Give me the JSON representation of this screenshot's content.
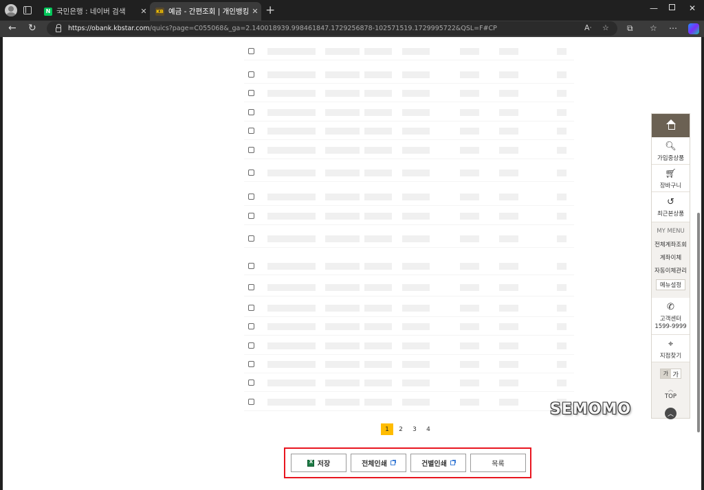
{
  "browser": {
    "tabs": [
      {
        "title": "국민은행 : 네이버 검색",
        "favicon": "N"
      },
      {
        "title": "예금 - 간편조회 | 개인뱅킹 | 조회",
        "favicon": "KB"
      }
    ],
    "url_host": "https://obank.kbstar.com",
    "url_path": "/quics?page=C055068&_ga=2.140018939.998461847.1729256878-102571519.1729995722&QSL=F#CP"
  },
  "pagination": {
    "pages": [
      "1",
      "2",
      "3",
      "4"
    ],
    "active": "1"
  },
  "actions": {
    "save": "저장",
    "print_all": "전체인쇄",
    "print_each": "건별인쇄",
    "list": "목록"
  },
  "quick_menu": {
    "joined_products": "가입중상품",
    "cart": "장바구니",
    "recent": "최근본상품",
    "my_menu_title": "MY MENU",
    "all_accounts": "전체계좌조회",
    "transfer": "계좌이체",
    "auto_transfer": "자동이체관리",
    "menu_settings": "메뉴설정",
    "customer_center": "고객센터",
    "phone": "1599-9999",
    "find_branch": "지점찾기",
    "font_small": "가",
    "font_large": "가",
    "top": "TOP"
  },
  "watermark": "SEMOMO"
}
